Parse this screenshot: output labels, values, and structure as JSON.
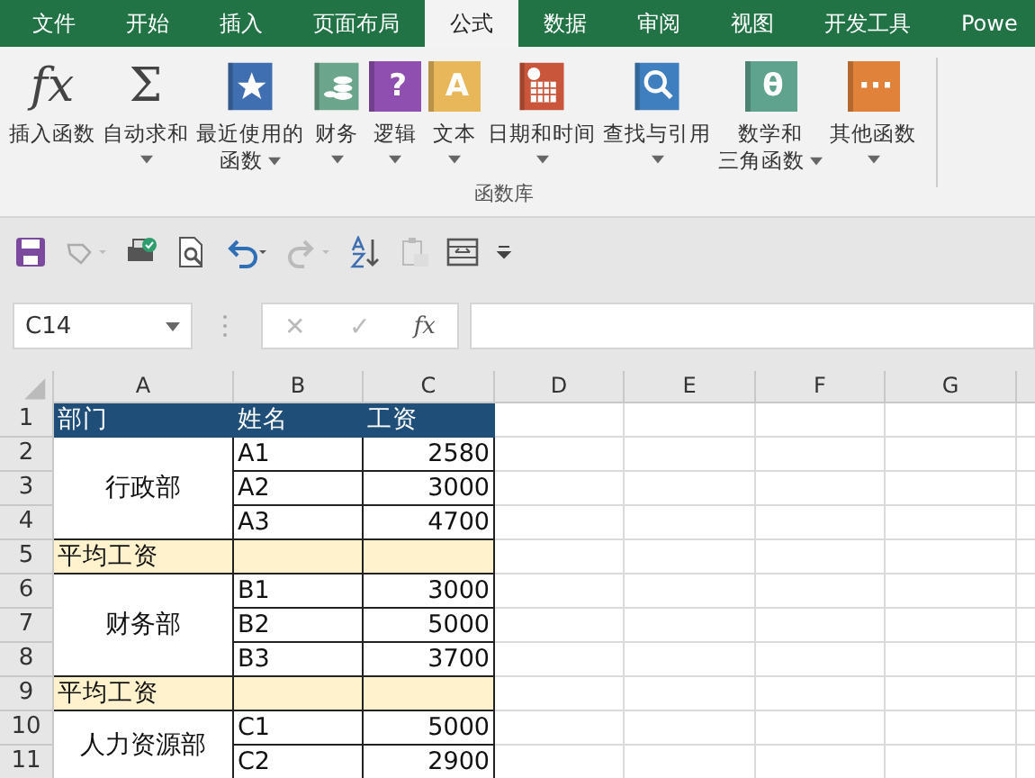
{
  "tabs": [
    {
      "label": "文件",
      "selected": false
    },
    {
      "label": "开始",
      "selected": false
    },
    {
      "label": "插入",
      "selected": false
    },
    {
      "label": "页面布局",
      "selected": false
    },
    {
      "label": "公式",
      "selected": true
    },
    {
      "label": "数据",
      "selected": false
    },
    {
      "label": "审阅",
      "selected": false
    },
    {
      "label": "视图",
      "selected": false
    },
    {
      "label": "开发工具",
      "selected": false
    },
    {
      "label": "Powe",
      "selected": false
    }
  ],
  "ribbon": {
    "group_label": "函数库",
    "buttons": [
      {
        "kind": "glyph",
        "glyph": "fx",
        "lines": [
          "插入函数"
        ],
        "dropdown": false
      },
      {
        "kind": "glyph",
        "glyph": "Σ",
        "lines": [
          "自动求和"
        ],
        "dropdown": true
      },
      {
        "kind": "star",
        "color": "#3f6fb0",
        "lines": [
          "最近使用的",
          "函数"
        ],
        "dropdown": true
      },
      {
        "kind": "coins",
        "color": "#6aa58c",
        "lines": [
          "财务"
        ],
        "dropdown": true
      },
      {
        "kind": "letter",
        "glyph": "?",
        "color": "#8e4fb0",
        "lines": [
          "逻辑"
        ],
        "dropdown": true
      },
      {
        "kind": "letter",
        "glyph": "A",
        "color": "#e8b75a",
        "lines": [
          "文本"
        ],
        "dropdown": true
      },
      {
        "kind": "calendar",
        "color": "#c9553a",
        "lines": [
          "日期和时间"
        ],
        "dropdown": true
      },
      {
        "kind": "search",
        "color": "#3f7fbf",
        "lines": [
          "查找与引用"
        ],
        "dropdown": true
      },
      {
        "kind": "letter",
        "glyph": "θ",
        "color": "#5fa38e",
        "lines": [
          "数学和",
          "三角函数"
        ],
        "dropdown": true
      },
      {
        "kind": "letter",
        "glyph": "···",
        "color": "#e0823a",
        "lines": [
          "其他函数"
        ],
        "dropdown": true
      }
    ]
  },
  "formula_bar": {
    "name_box": "C14",
    "cancel": "✕",
    "enter": "✓",
    "fx": "fx"
  },
  "sheet": {
    "columns": [
      "A",
      "B",
      "C",
      "D",
      "E",
      "F",
      "G"
    ],
    "header": {
      "number": "1",
      "cells": [
        "部门",
        "姓名",
        "工资"
      ]
    },
    "sections": [
      {
        "kind": "group",
        "department": "行政部",
        "rows": [
          {
            "number": "2",
            "name": "A1",
            "salary": "2580"
          },
          {
            "number": "3",
            "name": "A2",
            "salary": "3000"
          },
          {
            "number": "4",
            "name": "A3",
            "salary": "4700"
          }
        ]
      },
      {
        "kind": "average",
        "number": "5",
        "label": "平均工资"
      },
      {
        "kind": "group",
        "department": "财务部",
        "rows": [
          {
            "number": "6",
            "name": "B1",
            "salary": "3000"
          },
          {
            "number": "7",
            "name": "B2",
            "salary": "5000"
          },
          {
            "number": "8",
            "name": "B3",
            "salary": "3700"
          }
        ]
      },
      {
        "kind": "average",
        "number": "9",
        "label": "平均工资"
      },
      {
        "kind": "group",
        "department": "人力资源部",
        "rows": [
          {
            "number": "10",
            "name": "C1",
            "salary": "5000"
          },
          {
            "number": "11",
            "name": "C2",
            "salary": "2900"
          }
        ]
      }
    ]
  }
}
